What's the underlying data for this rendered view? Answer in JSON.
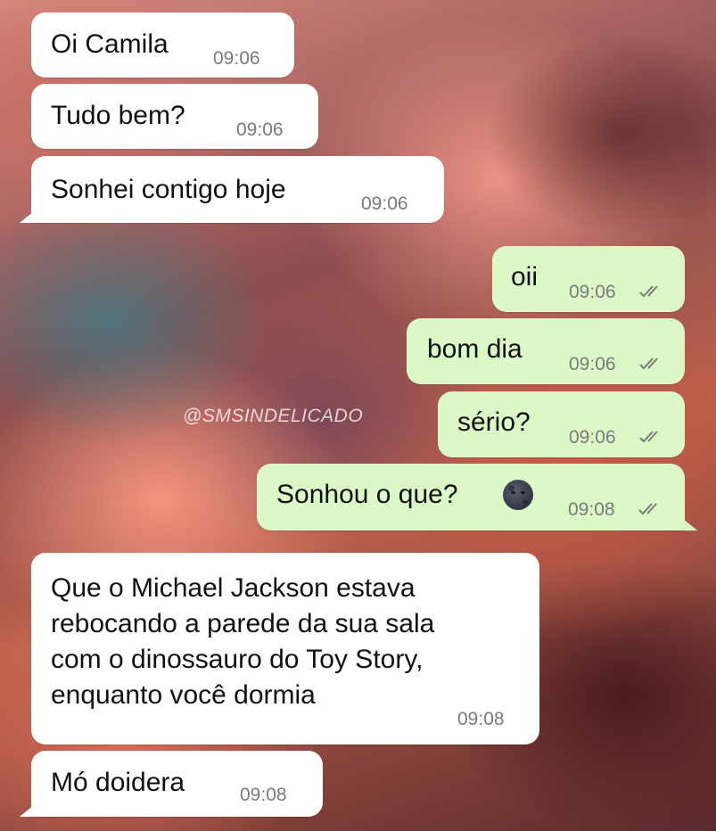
{
  "watermark": "@SMSINDELICADO",
  "messages": [
    {
      "dir": "in",
      "text": "Oi Camila",
      "time": "09:06"
    },
    {
      "dir": "in",
      "text": "Tudo bem?",
      "time": "09:06"
    },
    {
      "dir": "in",
      "text": "Sonhei contigo hoje",
      "time": "09:06"
    },
    {
      "dir": "out",
      "text": "oii",
      "time": "09:06",
      "status": "read-double-check"
    },
    {
      "dir": "out",
      "text": "bom dia",
      "time": "09:06",
      "status": "read-double-check"
    },
    {
      "dir": "out",
      "text": "sério?",
      "time": "09:06",
      "status": "read-double-check"
    },
    {
      "dir": "out",
      "text": "Sonhou o que?",
      "time": "09:08",
      "status": "read-double-check",
      "emoji": "new-moon-face-emoji"
    },
    {
      "dir": "in",
      "text_lines": [
        "Que o Michael Jackson estava",
        "rebocando a parede da sua sala",
        "com o dinossauro do Toy Story,",
        "enquanto você dormia"
      ],
      "time": "09:08"
    },
    {
      "dir": "in",
      "text": "Mó doidera",
      "time": "09:08"
    }
  ],
  "colors": {
    "incoming_bubble": "#ffffff",
    "outgoing_bubble": "#dcf8c6",
    "timestamp": "#7a7a7a"
  }
}
